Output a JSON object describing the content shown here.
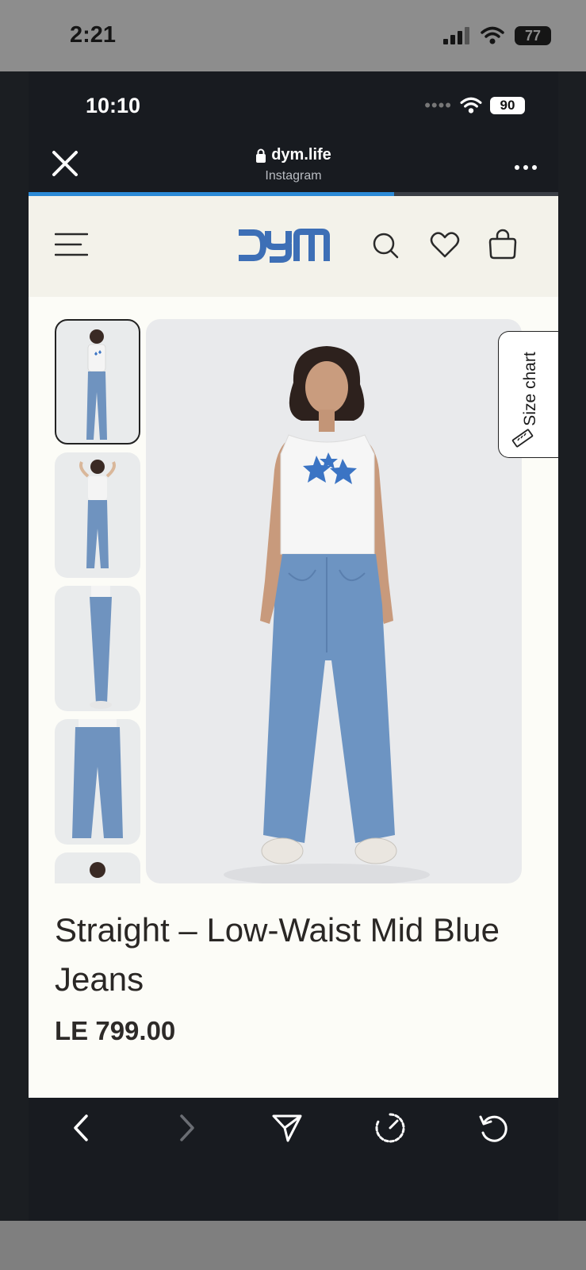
{
  "outer_status": {
    "time": "2:21",
    "battery": "77"
  },
  "inner_status": {
    "time": "10:10",
    "battery": "90",
    "signal_dots": "••••"
  },
  "browser": {
    "domain": "dym.life",
    "source": "Instagram",
    "load_progress": 0.69
  },
  "site": {
    "brand": "DYM",
    "header_icons": [
      "menu-icon",
      "search-icon",
      "heart-icon",
      "bag-icon"
    ]
  },
  "product": {
    "title": "Straight – Low-Waist Mid Blue Jeans",
    "price": "LE 799.00",
    "size_chart_label": "Size chart"
  },
  "bottom_nav": {
    "buttons": [
      "back",
      "forward",
      "share",
      "speed",
      "reload"
    ],
    "forward_enabled": false
  },
  "colors": {
    "brand_blue": "#3d6fb6",
    "browser_bg": "#181b20",
    "page_bg": "#fcfcf7",
    "header_bg": "#f3f2ea",
    "progress": "#2b8ad6"
  }
}
